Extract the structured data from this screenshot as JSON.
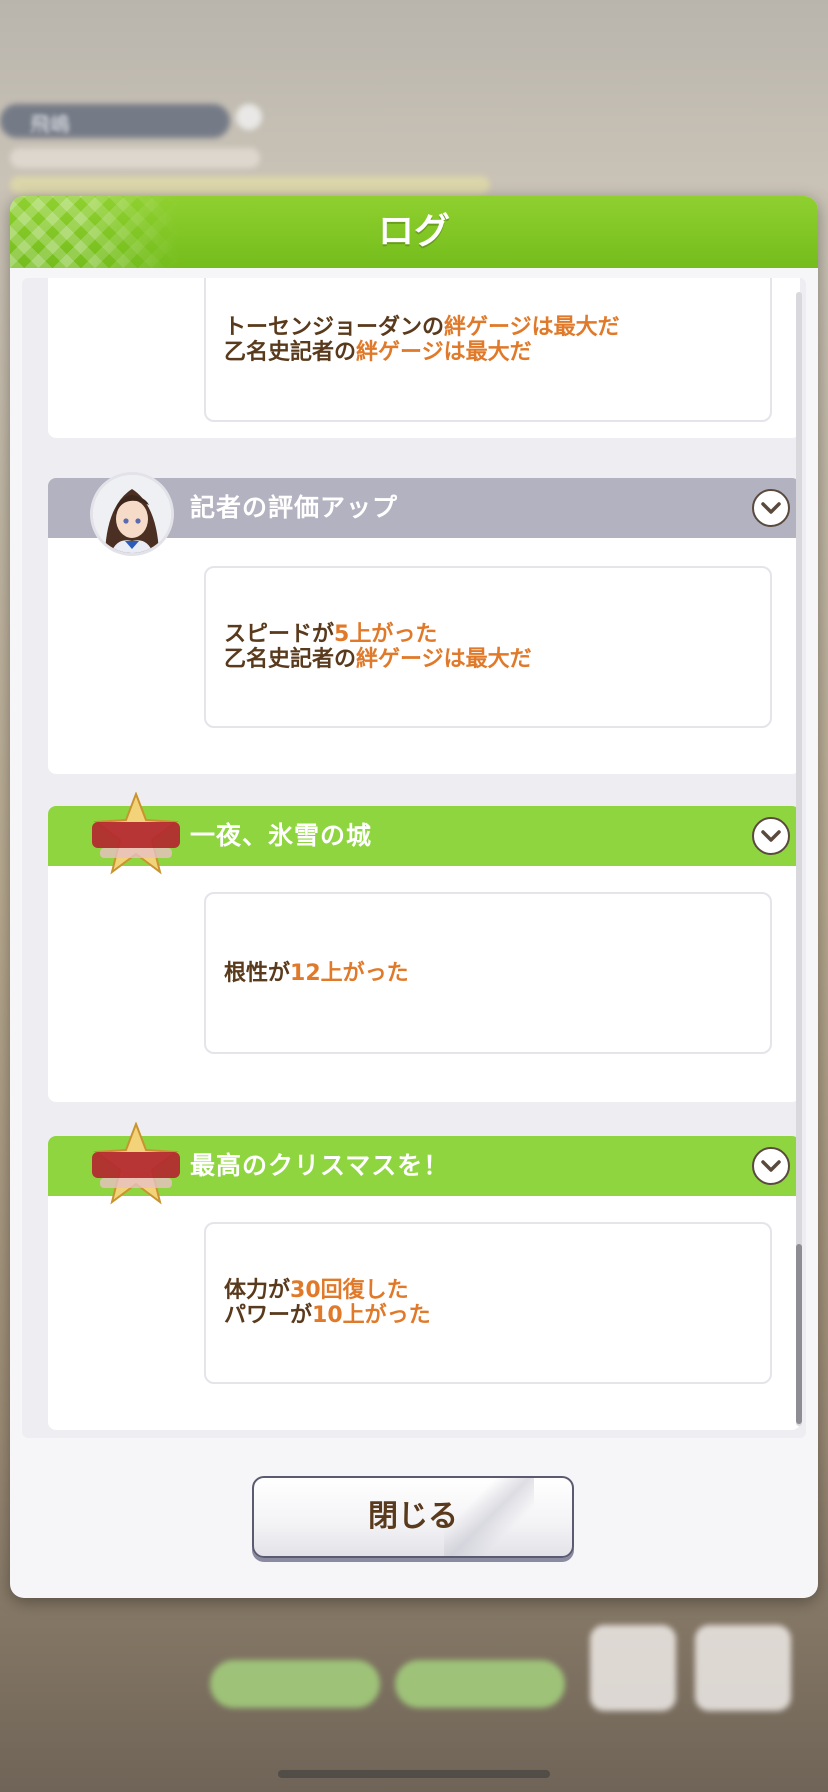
{
  "background": {
    "name_label": "飛嶋"
  },
  "dialog": {
    "title": "ログ",
    "close_label": "閉じる"
  },
  "log_entries": [
    {
      "lines": [
        [
          {
            "t": "トーセンジョーダンの",
            "h": false
          },
          {
            "t": "絆ゲージは最大だ",
            "h": true
          }
        ],
        [
          {
            "t": "乙名史記者の",
            "h": false
          },
          {
            "t": "絆ゲージは最大だ",
            "h": true
          }
        ]
      ]
    },
    {
      "title": "記者の評価アップ",
      "header_color": "gray",
      "icon": "reporter-avatar",
      "lines": [
        [
          {
            "t": "スピードが",
            "h": false
          },
          {
            "t": "5上がった",
            "h": true
          }
        ],
        [
          {
            "t": "乙名史記者の",
            "h": false
          },
          {
            "t": "絆ゲージは最大だ",
            "h": true
          }
        ]
      ]
    },
    {
      "title": "一夜、氷雪の城",
      "header_color": "green",
      "icon": "make-a-new-track-badge",
      "lines": [
        [
          {
            "t": "根性が",
            "h": false
          },
          {
            "t": "12上がった",
            "h": true
          }
        ]
      ]
    },
    {
      "title": "最高のクリスマスを！",
      "header_color": "green",
      "icon": "make-a-new-track-badge",
      "lines": [
        [
          {
            "t": "体力が",
            "h": false
          },
          {
            "t": "30回復した",
            "h": true
          }
        ],
        [
          {
            "t": "パワーが",
            "h": false
          },
          {
            "t": "10上がった",
            "h": true
          }
        ]
      ]
    }
  ],
  "colors": {
    "header_green": "#8fd53f",
    "header_gray": "#b2b2c0",
    "highlight_orange": "#e07a2a",
    "text_brown": "#5a3a1c"
  }
}
